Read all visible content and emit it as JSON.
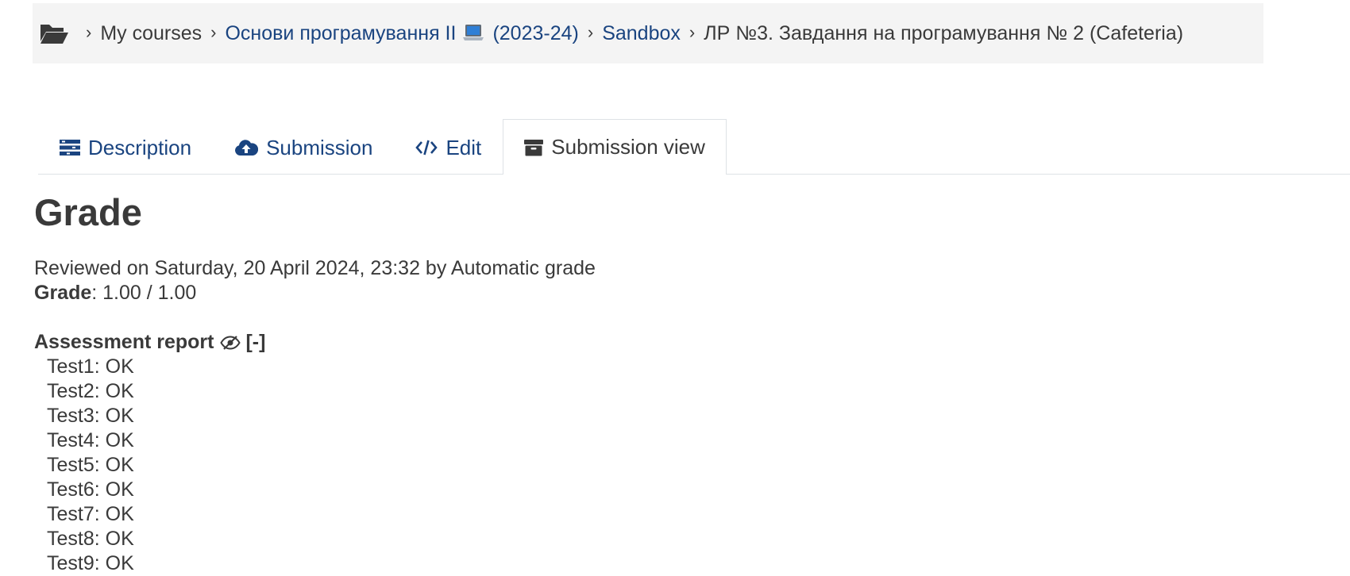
{
  "breadcrumb": {
    "icon": "folder-open-icon",
    "items": [
      {
        "label": "My courses",
        "link": false
      },
      {
        "label": "Основи програмування II",
        "suffix_icon": "laptop-icon",
        "after": "(2023-24)",
        "link": true
      },
      {
        "label": "Sandbox",
        "link": true
      },
      {
        "label": "ЛР №3. Завдання на програмування № 2 (Cafeteria)",
        "link": false
      }
    ]
  },
  "tabs": [
    {
      "label": "Description",
      "icon": "list-icon",
      "active": false
    },
    {
      "label": "Submission",
      "icon": "cloud-upload-icon",
      "active": false
    },
    {
      "label": "Edit",
      "icon": "code-icon",
      "active": false
    },
    {
      "label": "Submission view",
      "icon": "archive-icon",
      "active": true
    }
  ],
  "grade": {
    "title": "Grade",
    "reviewed": "Reviewed on Saturday, 20 April 2024, 23:32 by Automatic grade",
    "grade_label": "Grade",
    "grade_value": ": 1.00 / 1.00"
  },
  "report": {
    "title": "Assessment report",
    "icon": "eye-slash-icon",
    "toggle": "[-]",
    "tests": [
      "Test1: OK",
      "Test2: OK",
      "Test3: OK",
      "Test4: OK",
      "Test5: OK",
      "Test6: OK",
      "Test7: OK",
      "Test8: OK",
      "Test9: OK"
    ]
  },
  "colors": {
    "link": "#1a4480",
    "text": "#3a3a3a",
    "breadcrumb_bg": "#f4f4f4"
  }
}
